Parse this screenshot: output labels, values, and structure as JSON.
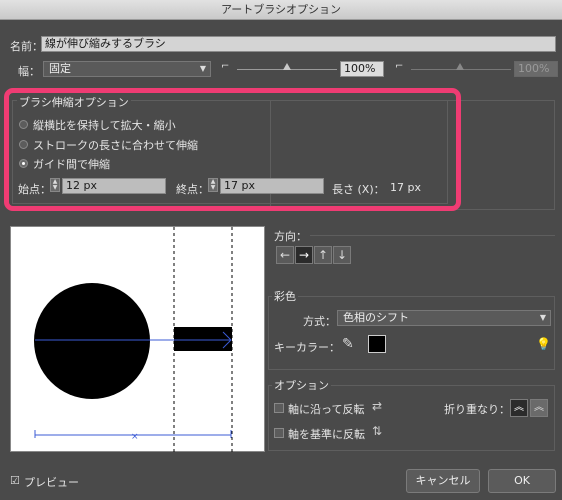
{
  "window": {
    "title": "アートブラシオプション"
  },
  "name": {
    "label": "名前：",
    "value": "線が伸び縮みするブラシ"
  },
  "width": {
    "label": "幅：",
    "select_value": "固定",
    "percent1": "100%",
    "percent2": "100%"
  },
  "scale_options": {
    "title": "ブラシ伸縮オプション",
    "options": [
      {
        "label": "縦横比を保持して拡大・縮小",
        "selected": false
      },
      {
        "label": "ストロークの長さに合わせて伸縮",
        "selected": false
      },
      {
        "label": "ガイド間で伸縮",
        "selected": true
      }
    ],
    "start_label": "始点：",
    "start_value": "12 px",
    "end_label": "終点：",
    "end_value": "17 px",
    "length_label": "長さ (X)：",
    "length_value": "17 px"
  },
  "direction": {
    "label": "方向：",
    "buttons": [
      "←",
      "→",
      "↑",
      "↓"
    ],
    "selected_index": 1
  },
  "colorization": {
    "section_label": "彩色",
    "method_label": "方式：",
    "method_value": "色相のシフト",
    "key_color_label": "キーカラー：",
    "key_color": "#000000"
  },
  "options": {
    "section_label": "オプション",
    "flip_along": "軸に沿って反転",
    "flip_across": "軸を基準に反転",
    "overlap_label": "折り重なり："
  },
  "footer": {
    "preview_label": "プレビュー",
    "preview_checked": true,
    "cancel_label": "キャンセル",
    "ok_label": "OK"
  },
  "accent": {
    "highlight": "#ef3c73",
    "arrow": "#3b5bd6"
  }
}
